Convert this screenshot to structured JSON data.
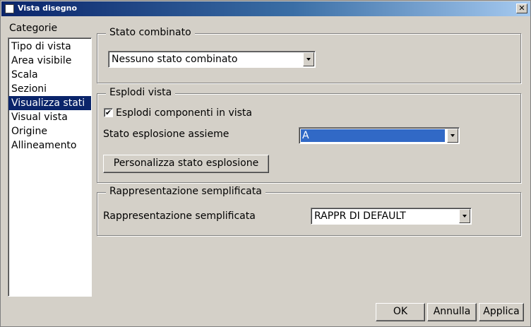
{
  "window": {
    "title": "Vista disegno",
    "close_glyph": "✕"
  },
  "categories": {
    "label": "Categorie",
    "items": [
      {
        "label": "Tipo di vista",
        "selected": false
      },
      {
        "label": "Area visibile",
        "selected": false
      },
      {
        "label": "Scala",
        "selected": false
      },
      {
        "label": "Sezioni",
        "selected": false
      },
      {
        "label": "Visualizza stati",
        "selected": true
      },
      {
        "label": "Visual vista",
        "selected": false
      },
      {
        "label": "Origine",
        "selected": false
      },
      {
        "label": "Allineamento",
        "selected": false
      }
    ]
  },
  "combined_state": {
    "label": "Stato combinato",
    "value": "Nessuno stato combinato"
  },
  "explode_view": {
    "label": "Esplodi vista",
    "checkbox_label": "Esplodi componenti in vista",
    "checkbox_checked": true,
    "check_glyph": "✔",
    "assembly_state_label": "Stato esplosione assieme",
    "assembly_state_value": "A",
    "customize_button": "Personalizza stato esplosione"
  },
  "simplified_rep": {
    "label": "Rappresentazione semplificata",
    "field_label": "Rappresentazione semplificata",
    "value": "RAPPR DI DEFAULT"
  },
  "footer": {
    "ok": "OK",
    "cancel": "Annulla",
    "apply": "Applica"
  },
  "colors": {
    "selection": "#0a246a",
    "combo_selection": "#3169c6",
    "face": "#d4d0c8"
  }
}
